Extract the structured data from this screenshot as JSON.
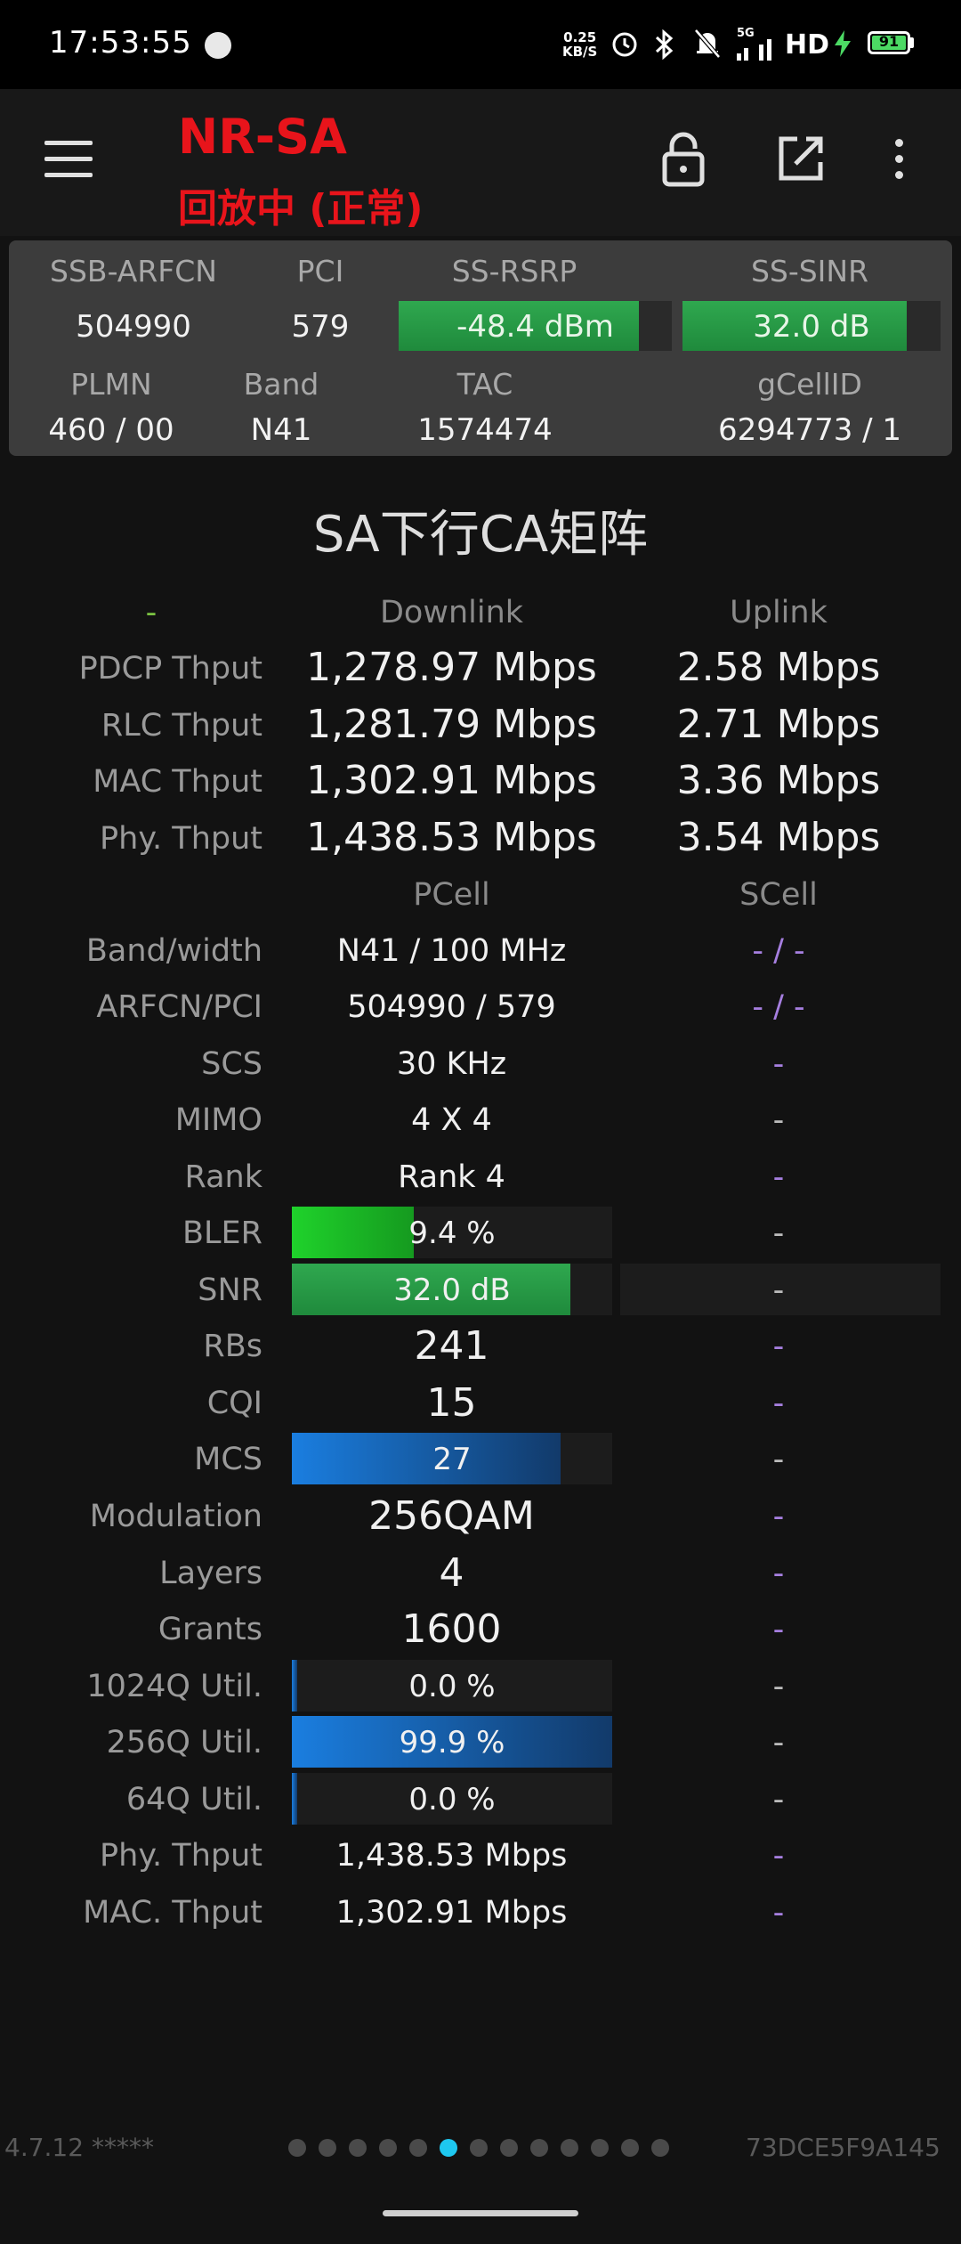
{
  "status_bar": {
    "time": "17:53:55",
    "speed_value": "0.25",
    "speed_unit": "KB/S",
    "network": "5G",
    "hd": "HD",
    "battery": "91",
    "battery_level": 0.91,
    "colors": {
      "battery": "#4cd964",
      "charging": "#4cd964"
    }
  },
  "app_bar": {
    "title": "NR-SA",
    "subtitle": "回放中 (正常)",
    "title_color": "#e8141b",
    "icons": [
      "menu-icon",
      "lock-icon",
      "share-icon",
      "more-vert-icon"
    ]
  },
  "info_panel": {
    "headers1": [
      "SSB-ARFCN",
      "PCI",
      "SS-RSRP",
      "SS-SINR"
    ],
    "ssb_arfcn": "504990",
    "pci": "579",
    "rsrp": {
      "text": "-48.4 dBm",
      "level": 0.88
    },
    "sinr": {
      "text": "32.0 dB",
      "level": 0.87
    },
    "headers2": [
      "PLMN",
      "Band",
      "TAC",
      "gCellID"
    ],
    "plmn": "460 / 00",
    "band": "N41",
    "tac": "1574474",
    "gcellid": "6294773 / 1"
  },
  "section_title": "SA下行CA矩阵",
  "throughput": {
    "col_marker": "-",
    "col_downlink": "Downlink",
    "col_uplink": "Uplink",
    "rows": [
      {
        "label": "PDCP Thput",
        "dl": "1,278.97 Mbps",
        "ul": "2.58 Mbps"
      },
      {
        "label": "RLC Thput",
        "dl": "1,281.79 Mbps",
        "ul": "2.71 Mbps"
      },
      {
        "label": "MAC Thput",
        "dl": "1,302.91 Mbps",
        "ul": "3.36 Mbps"
      },
      {
        "label": "Phy. Thput",
        "dl": "1,438.53 Mbps",
        "ul": "3.54 Mbps"
      }
    ]
  },
  "cells": {
    "col_pcell": "PCell",
    "col_scell": "SCell",
    "band_width": {
      "label": "Band/width",
      "p": "N41 / 100 MHz",
      "s": "- / -"
    },
    "arfcn_pci": {
      "label": "ARFCN/PCI",
      "p": "504990 / 579",
      "s": "- / -"
    },
    "scs": {
      "label": "SCS",
      "p": "30 KHz",
      "s": "-"
    },
    "mimo": {
      "label": "MIMO",
      "p": "4 X 4",
      "s": "-"
    },
    "rank": {
      "label": "Rank",
      "p": "Rank 4",
      "s": "-"
    },
    "bler": {
      "label": "BLER",
      "p": "9.4 %",
      "s": "-",
      "level": 0.38
    },
    "snr": {
      "label": "SNR",
      "p": "32.0 dB",
      "s": "-",
      "level": 0.87
    },
    "rbs": {
      "label": "RBs",
      "p": "241",
      "s": "-"
    },
    "cqi": {
      "label": "CQI",
      "p": "15",
      "s": "-"
    },
    "mcs": {
      "label": "MCS",
      "p": "27",
      "s": "-",
      "level": 0.84
    },
    "modulation": {
      "label": "Modulation",
      "p": "256QAM",
      "s": "-"
    },
    "layers": {
      "label": "Layers",
      "p": "4",
      "s": "-"
    },
    "grants": {
      "label": "Grants",
      "p": "1600",
      "s": "-"
    },
    "q1024": {
      "label": "1024Q Util.",
      "p": "0.0 %",
      "s": "-",
      "level": 0.0
    },
    "q256": {
      "label": "256Q Util.",
      "p": "99.9 %",
      "s": "-",
      "level": 0.999
    },
    "q64": {
      "label": "64Q Util.",
      "p": "0.0 %",
      "s": "-",
      "level": 0.0
    },
    "phy": {
      "label": "Phy. Thput",
      "p": "1,438.53 Mbps",
      "s": "-"
    },
    "mac": {
      "label": "MAC. Thput",
      "p": "1,302.91 Mbps",
      "s": "-"
    }
  },
  "footer": {
    "version": "4.7.12 *****",
    "device_id": "73DCE5F9A145",
    "page_count": 13,
    "active_page": 5
  },
  "colors": {
    "background": "#121212",
    "panel": "#3c3c3c",
    "meter_green": "#2fa84f",
    "bar_blue": "#1a7ee0",
    "scell_dash": "#a67fe0",
    "active_dot": "#1ec8f0"
  }
}
